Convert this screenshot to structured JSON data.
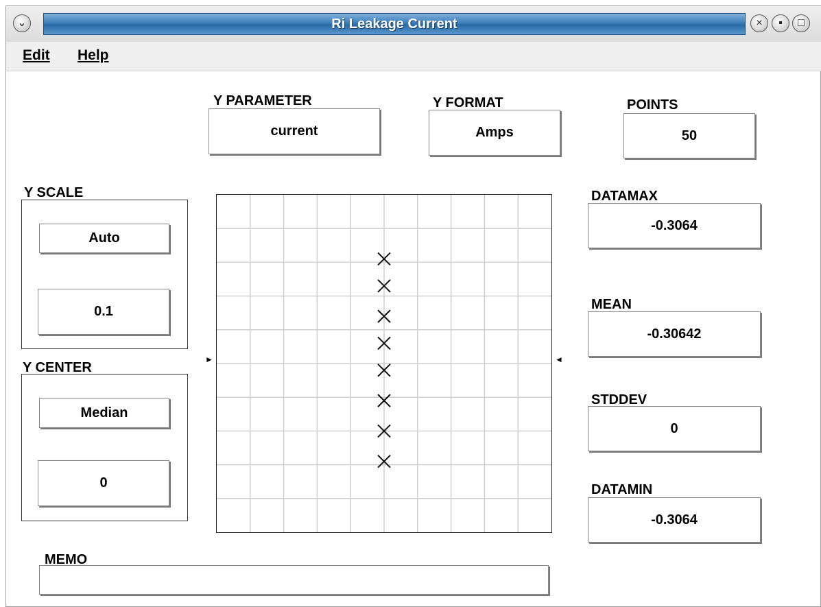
{
  "window": {
    "title": "Ri Leakage Current"
  },
  "menu": {
    "edit": "Edit",
    "help": "Help"
  },
  "y_parameter": {
    "label": "Y PARAMETER",
    "value": "current"
  },
  "y_format": {
    "label": "Y FORMAT",
    "value": "Amps"
  },
  "points": {
    "label": "POINTS",
    "value": "50"
  },
  "y_scale": {
    "label": "Y SCALE",
    "mode": "Auto",
    "value": "0.1"
  },
  "y_center": {
    "label": "Y CENTER",
    "mode": "Median",
    "value": "0"
  },
  "stats": {
    "datamax": {
      "label": "DATAMAX",
      "value": "-0.3064"
    },
    "mean": {
      "label": "MEAN",
      "value": "-0.30642"
    },
    "stddev": {
      "label": "STDDEV",
      "value": "0"
    },
    "datamin": {
      "label": "DATAMIN",
      "value": "-0.3064"
    }
  },
  "memo": {
    "label": "MEMO",
    "value": ""
  },
  "chart_data": {
    "type": "scatter",
    "grid": true,
    "point_marker": "x",
    "x": [
      0,
      0,
      0,
      0,
      0,
      0,
      0,
      0
    ],
    "y_positions_relative": [
      0.19,
      0.27,
      0.36,
      0.44,
      0.52,
      0.61,
      0.7,
      0.79
    ]
  }
}
